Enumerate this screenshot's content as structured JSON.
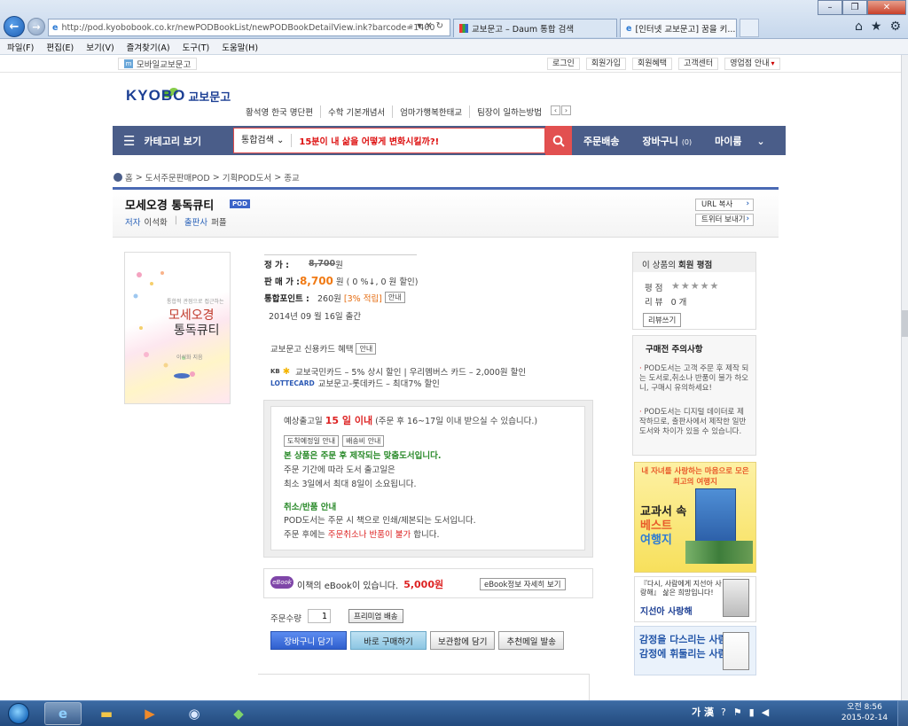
{
  "browser": {
    "address": "http://pod.kyobobook.co.kr/newPODBookList/newPODBookDetailView.ink?barcode=1400",
    "address_host": "pod.kyobobook.co.kr",
    "tabs": [
      {
        "label": "교보문고 – Daum 통합 검색"
      },
      {
        "label": "[인터넷 교보문고] 꿈을 키..."
      }
    ],
    "menu": [
      "파일(F)",
      "편집(E)",
      "보기(V)",
      "즐겨찾기(A)",
      "도구(T)",
      "도움말(H)"
    ]
  },
  "util": {
    "mobile": "모바일교보문고",
    "links": [
      "로그인",
      "회원가입",
      "회원혜택",
      "고객센터",
      "영업점 안내"
    ]
  },
  "header": {
    "logo_en": "KYOBO",
    "logo_kr": "교보문고",
    "keywords": [
      "황석영 한국 명단편",
      "수학 기본개념서",
      "엄마가행복한태교",
      "팀장이 일하는방법"
    ]
  },
  "nav": {
    "category": "카테고리 보기",
    "search_scope": "통합검색",
    "search_value": "15분이 내 삶을 어떻게 변화시킬까?!",
    "order": "주문배송",
    "cart": "장바구니",
    "cart_count": "(0)",
    "mypage": "마이룸"
  },
  "breadcrumb": [
    "홈",
    "도서주문판매POD",
    "기획POD도서",
    "종교"
  ],
  "book": {
    "title": "모세오경 통독큐티",
    "badge": "POD",
    "author_label": "저자",
    "author": "이석화",
    "publisher_label": "출판사",
    "publisher": "퍼플",
    "url_copy": "URL 복사",
    "twitter": "트위터 보내기",
    "cover_title_1": "모세오경",
    "cover_title_2": "통독큐티",
    "cover_subtitle": "통합적 관점으로 접근하는",
    "cover_author": "이석화 지음"
  },
  "price": {
    "list_label": "정 가 :",
    "list_value": "8,700",
    "won": "원",
    "sale_label": "판 매 가 :",
    "sale_value": "8,700",
    "discount": "원 ( 0 %↓, 0 원 할인)",
    "point_label": "통합포인트 :",
    "point_value": "260원",
    "point_rate": "[3% 적립]",
    "info": "안내",
    "pub_date": "2014년 09 월 16일 출간"
  },
  "card": {
    "benefit": "교보문고 신용카드 혜택",
    "kb_text": "교보국민카드 – 5% 상시 할인  |  우리멤버스 카드 – 2,000원 할인",
    "lotte_text": "교보문고-롯데카드 – 최대7% 할인",
    "kb_brand": "KB",
    "lotte_brand": "LOTTECARD"
  },
  "delivery": {
    "ship_prefix": "예상출고일",
    "ship_days": "15 일 이내",
    "ship_note": "(주문 후 16~17일 이내 받으실 수 있습니다.)",
    "btn_arrival": "도착예정일 안내",
    "btn_fee": "배송비 안내",
    "made_notice": "본 상품은 주문 후 제작되는 맞춤도서입니다.",
    "line1": "주문 기간에 따라 도서 출고일은",
    "line2": "최소 3일에서 최대 8일이 소요됩니다.",
    "ret_title": "취소/반품 안내",
    "ret1": "POD도서는 주문 시 책으로 인쇄/제본되는 도서입니다.",
    "ret2_a": "주문 후에는",
    "ret2_b": "주문취소나 반품이 불가",
    "ret2_c": "합니다."
  },
  "ebook": {
    "logo": "eBook",
    "text": "이책의 eBook이 있습니다.",
    "price": "5,000원",
    "info": "eBook정보 자세히 보기"
  },
  "order": {
    "qty_label": "주문수량",
    "qty": "1",
    "premium": "프리미엄 배송",
    "cart": "장바구니 담기",
    "buy": "바로 구매하기",
    "keep": "보관함에 담기",
    "mail": "추천메일 발송"
  },
  "rating": {
    "head_a": "이 상품의",
    "head_b": "회원 평점",
    "score_label": "평 점",
    "review_label": "리 뷰",
    "review_count": "0 개",
    "write": "리뷰쓰기",
    "stars_filled": 0,
    "stars_total": 5
  },
  "notice": {
    "title": "구매전 주의사항",
    "item1": "POD도서는 고객 주문 후 제작 되는 도서로,취소나 반품이 불가 하오니, 구매시 유의하세요!",
    "item2": "POD도서는 디지털 데이터로 제작하므로, 출판사에서 제작한 일반 도서와 차이가 있을 수 있습니다."
  },
  "banners": {
    "b1_head": "내 자녀를 사랑하는 마음으로 모은 최고의 여행지",
    "b1_l1": "교과서 속",
    "b1_l2": "베스트",
    "b1_l3": "여행지",
    "b2_text": "『다시, 사람에게 지선아 사랑해』 삶은 희망입니다!",
    "b2_title": "지선아 사랑해",
    "b3_l1": "감정을 다스리는 사람",
    "b3_l2": "감정에 휘둘리는 사람"
  },
  "taskbar": {
    "ime": "가 漢",
    "time": "오전 8:56",
    "date": "2015-02-14"
  },
  "colors": {
    "nav": "#4a5d89",
    "search_red": "#e25050",
    "brand_blue": "#1c3f94",
    "sale_orange": "#f07a14"
  }
}
